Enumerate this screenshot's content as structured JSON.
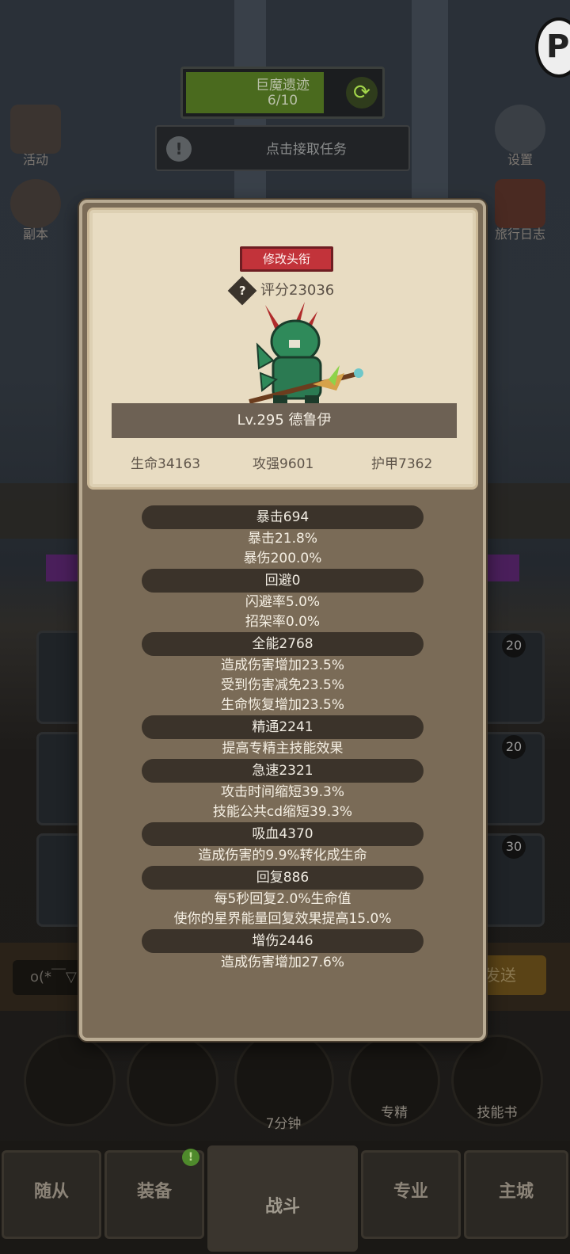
{
  "background": {
    "quest": {
      "title": "巨魔遗迹",
      "progress_text": "6/10",
      "progress": 0.6
    },
    "task_button": "点击接取任务",
    "side_left": [
      {
        "label": "活动",
        "icon": "scroll-board-icon"
      },
      {
        "label": "副本",
        "icon": "portal-icon"
      }
    ],
    "side_right": [
      {
        "label": "设置",
        "icon": "gear-icon"
      },
      {
        "label": "旅行日志",
        "icon": "book-icon"
      }
    ],
    "slot_levels": [
      "20",
      "20",
      "30"
    ],
    "chat_input": "o(*￣▽",
    "send_label": "发送",
    "bottom_timer": "7分钟",
    "bottom_labels": {
      "specialize": "专精",
      "skill_book": "技能书"
    },
    "nav": [
      "随从",
      "装备",
      "战斗",
      "专业",
      "主城"
    ],
    "nav_active": "战斗",
    "equip_badge": "!"
  },
  "modal": {
    "title_button": "修改头衔",
    "score": "评分23036",
    "help": "?",
    "hero_name": "Lv.295 德鲁伊",
    "stats": {
      "health": "生命34163",
      "attack": "攻强9601",
      "armor": "护甲7362"
    },
    "sections": [
      {
        "header": "暴击694",
        "lines": [
          "暴击21.8%",
          "暴伤200.0%"
        ]
      },
      {
        "header": "回避0",
        "lines": [
          "闪避率5.0%",
          "招架率0.0%"
        ]
      },
      {
        "header": "全能2768",
        "lines": [
          "造成伤害增加23.5%",
          "受到伤害减免23.5%",
          "生命恢复增加23.5%"
        ]
      },
      {
        "header": "精通2241",
        "lines": [
          "提高专精主技能效果"
        ]
      },
      {
        "header": "急速2321",
        "lines": [
          "攻击时间缩短39.3%",
          "技能公共cd缩短39.3%"
        ]
      },
      {
        "header": "吸血4370",
        "lines": [
          "造成伤害的9.9%转化成生命"
        ]
      },
      {
        "header": "回复886",
        "lines": [
          "每5秒回复2.0%生命值",
          "使你的星界能量回复效果提高15.0%"
        ]
      },
      {
        "header": "增伤2446",
        "lines": [
          "造成伤害增加27.6%"
        ]
      }
    ]
  }
}
